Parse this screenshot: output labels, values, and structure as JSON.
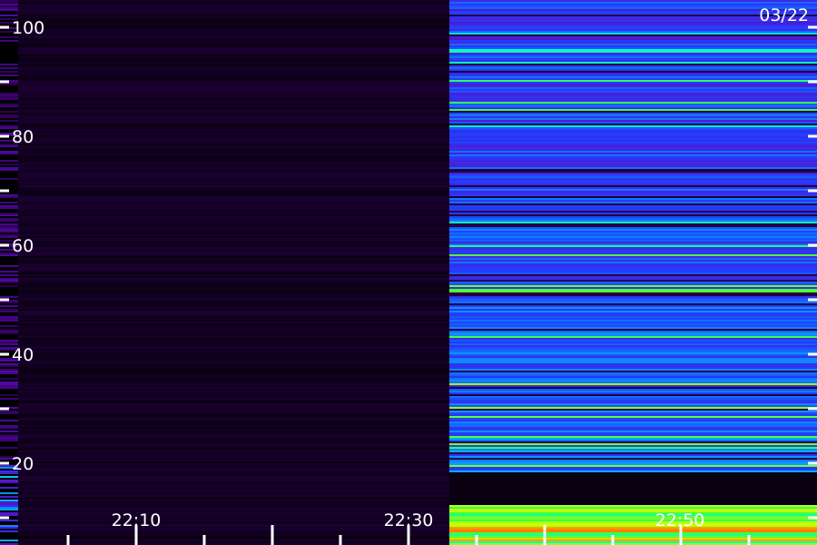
{
  "chart_data": {
    "type": "heatmap",
    "title": "",
    "xlabel": "",
    "ylabel": "",
    "date_label": "03/22",
    "x_tick_labels": [
      "22:10",
      "22:30",
      "22:50"
    ],
    "y_tick_labels": [
      "20",
      "40",
      "60",
      "80",
      "100"
    ],
    "ylim": [
      10,
      105
    ],
    "xlim": [
      "22:00",
      "23:00"
    ],
    "colormap": [
      "#000000",
      "#3a006a",
      "#5a10c8",
      "#2040ff",
      "#00b0ff",
      "#00ffd0",
      "#40ff40",
      "#d0ff00",
      "#ff8000"
    ],
    "data_segments": [
      {
        "x_start": "22:00",
        "x_end": "22:02.5",
        "level": "moderate"
      },
      {
        "x_start": "22:02.5",
        "x_end": "22:36",
        "level": "near zero"
      },
      {
        "x_start": "22:36",
        "x_end": "23:00",
        "level": "high"
      }
    ]
  }
}
